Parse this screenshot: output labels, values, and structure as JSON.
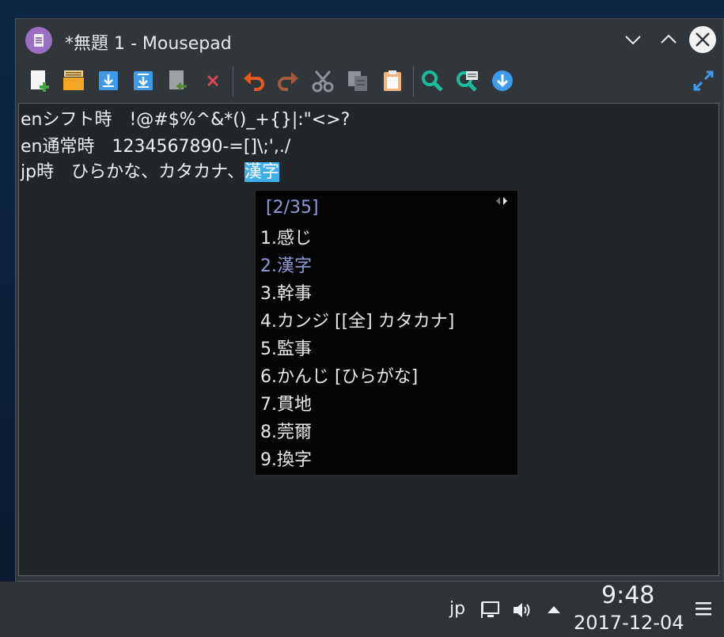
{
  "window": {
    "title": "*無題 1 - Mousepad",
    "app_icon": "mousepad-icon",
    "controls": [
      "minimize-chevron-icon",
      "maximize-chevron-icon",
      "close-icon"
    ]
  },
  "toolbar": {
    "buttons": [
      {
        "name": "new-document",
        "icon": "new-document-icon"
      },
      {
        "name": "open-file",
        "icon": "open-folder-icon"
      },
      {
        "name": "save",
        "icon": "save-icon"
      },
      {
        "name": "save-as",
        "icon": "save-as-icon"
      },
      {
        "name": "revert",
        "icon": "revert-icon"
      },
      {
        "name": "close-document",
        "icon": "close-x-icon"
      },
      {
        "name": "undo",
        "icon": "undo-icon"
      },
      {
        "name": "redo",
        "icon": "redo-icon"
      },
      {
        "name": "cut",
        "icon": "cut-icon"
      },
      {
        "name": "copy",
        "icon": "copy-icon"
      },
      {
        "name": "paste",
        "icon": "paste-icon"
      },
      {
        "name": "find",
        "icon": "find-icon"
      },
      {
        "name": "find-replace",
        "icon": "find-replace-icon"
      },
      {
        "name": "go-to",
        "icon": "go-down-icon"
      },
      {
        "name": "fullscreen",
        "icon": "fullscreen-icon"
      }
    ]
  },
  "editor": {
    "lines": [
      {
        "text": "enシフト時　!@#$%^&*()_+{}|:\"<>?"
      },
      {
        "text": "en通常時　1234567890-=[]\\;',./"
      },
      {
        "prefix": "jp時　ひらかな、カタカナ、",
        "selected": "漢字"
      }
    ]
  },
  "ime": {
    "page": "[2/35]",
    "candidates": [
      {
        "num": "1.",
        "text": "感じ"
      },
      {
        "num": "2.",
        "text": "漢字",
        "active": true
      },
      {
        "num": "3.",
        "text": "幹事"
      },
      {
        "num": "4.",
        "text": "カンジ [[全] カタカナ]"
      },
      {
        "num": "5.",
        "text": "監事"
      },
      {
        "num": "6.",
        "text": "かんじ [ひらがな]"
      },
      {
        "num": "7.",
        "text": "貫地"
      },
      {
        "num": "8.",
        "text": "莞爾"
      },
      {
        "num": "9.",
        "text": "換字"
      }
    ]
  },
  "panel": {
    "keyboard_layout": "jp",
    "clock_time": "9:48",
    "clock_date": "2017-12-04"
  },
  "colors": {
    "selection": "#3daee9",
    "ime_highlight": "#8e9bd6",
    "window_bg": "#31363b",
    "editor_bg": "#232629"
  }
}
